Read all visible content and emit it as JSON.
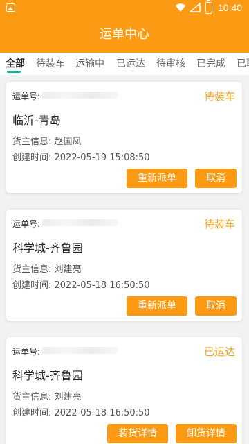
{
  "status_bar": {
    "time": "10:40",
    "icons": [
      "image-icon",
      "wifi-icon",
      "signal-icon",
      "battery-icon"
    ]
  },
  "app": {
    "title": "运单中心",
    "accent": "#fc9a13"
  },
  "tabs": [
    {
      "label": "全部"
    },
    {
      "label": "待装车"
    },
    {
      "label": "运输中"
    },
    {
      "label": "已运达"
    },
    {
      "label": "待审核"
    },
    {
      "label": "已完成"
    },
    {
      "label": "已取"
    }
  ],
  "orders": [
    {
      "order_label": "运单号:",
      "status": "待装车",
      "route": "临沂-青岛",
      "owner": "货主信息: 赵国凤",
      "created": "创建时间: 2022-05-19 15:08:50",
      "actions": [
        "重新派单",
        "取消"
      ]
    },
    {
      "order_label": "运单号:",
      "status": "待装车",
      "route": "科学城-齐鲁园",
      "owner": "货主信息: 刘建亮",
      "created": "创建时间: 2022-05-18 16:50:50",
      "actions": [
        "重新派单",
        "取消"
      ]
    },
    {
      "order_label": "运单号:",
      "status": "已运达",
      "route": "科学城-齐鲁园",
      "owner": "货主信息: 刘建亮",
      "created": "创建时间: 2022-05-18 16:50:50",
      "actions": [
        "装货详情",
        "卸货详情"
      ]
    }
  ]
}
